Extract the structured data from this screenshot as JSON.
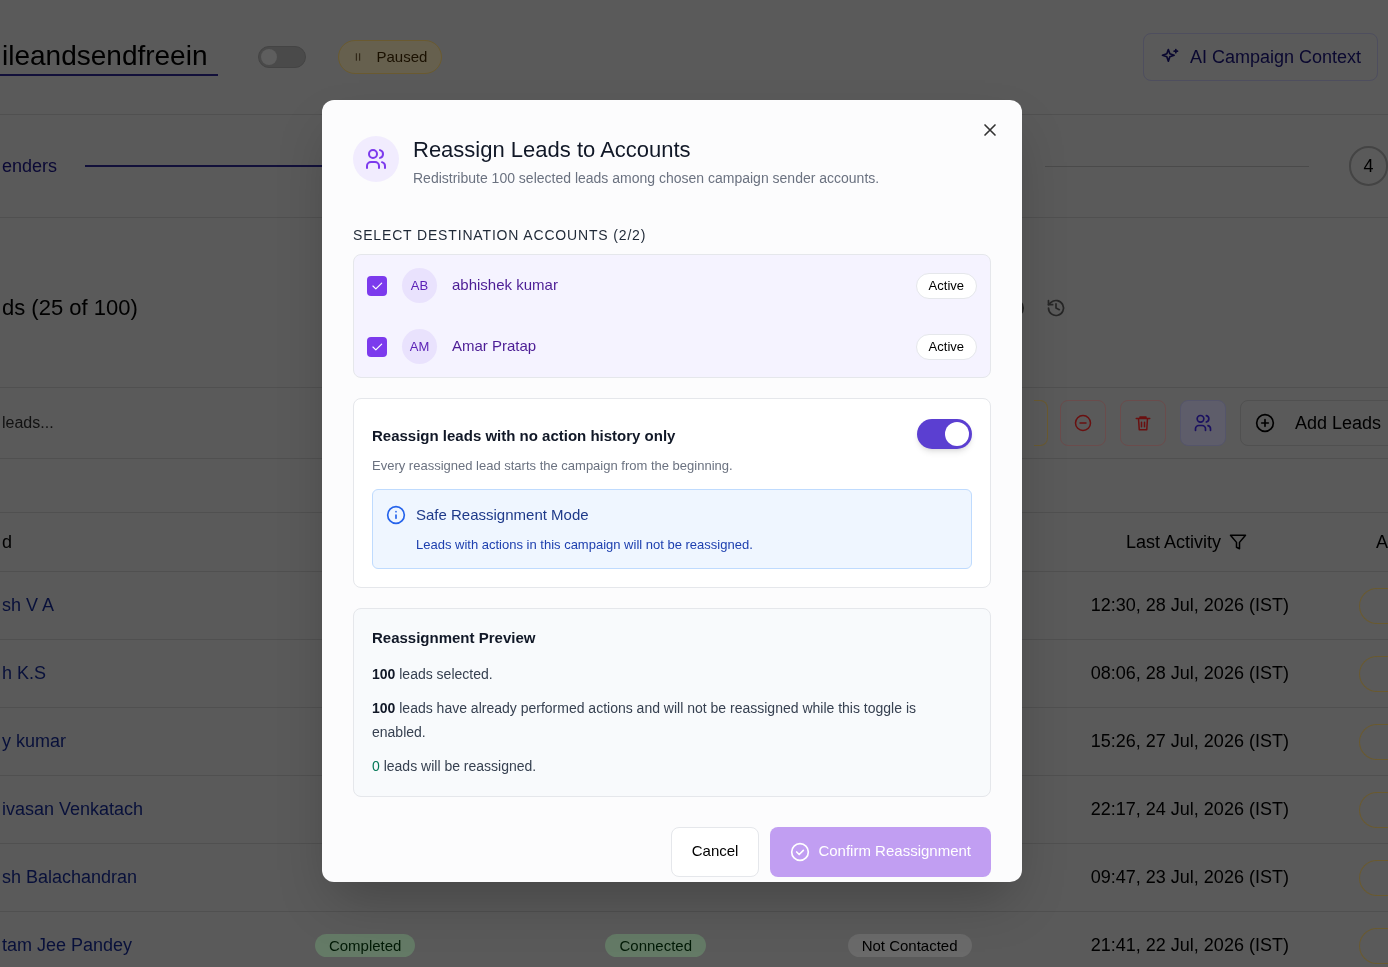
{
  "page": {
    "title": "ileandsendfreein",
    "campaign_toggle": {
      "on": false
    },
    "status": "Paused",
    "ai_button": "AI Campaign Context",
    "tab": "enders",
    "step": "4",
    "leads_heading": "ds (25 of 100)",
    "search": {
      "placeholder": "leads..."
    },
    "add_leads": "Add Leads",
    "table": {
      "columns": [
        "d",
        "Last Activity",
        "A"
      ],
      "rows": [
        {
          "name": "sh V A",
          "last_activity": "12:30, 28 Jul, 2026 (IST)"
        },
        {
          "name": "h K.S",
          "last_activity": "08:06, 28 Jul, 2026 (IST)"
        },
        {
          "name": "y kumar",
          "last_activity": "15:26, 27 Jul, 2026 (IST)"
        },
        {
          "name": "ivasan Venkatach",
          "last_activity": "22:17, 24 Jul, 2026 (IST)"
        },
        {
          "name": "sh Balachandran",
          "last_activity": "09:47, 23 Jul, 2026 (IST)"
        },
        {
          "name": "tam Jee Pandey",
          "status": "Completed",
          "connection": "Connected",
          "contact": "Not Contacted",
          "last_activity": "21:41, 22 Jul, 2026 (IST)"
        }
      ]
    }
  },
  "dialog": {
    "title": "Reassign Leads to Accounts",
    "subtitle": "Redistribute 100 selected leads among chosen campaign sender accounts.",
    "section_label": "SELECT DESTINATION ACCOUNTS (2/2)",
    "accounts": [
      {
        "initials": "AB",
        "name": "abhishek kumar",
        "status": "Active",
        "checked": true
      },
      {
        "initials": "AM",
        "name": "Amar Pratap",
        "status": "Active",
        "checked": true
      }
    ],
    "toggle": {
      "label": "Reassign leads with no action history only",
      "description": "Every reassigned lead starts the campaign from the beginning.",
      "on": true
    },
    "info": {
      "title": "Safe Reassignment Mode",
      "text": "Leads with actions in this campaign will not be reassigned."
    },
    "preview": {
      "title": "Reassignment Preview",
      "lines": [
        {
          "kind": "count",
          "count": "100",
          "text": "leads selected."
        },
        {
          "kind": "count",
          "count": "100",
          "text": "leads have already performed actions and will not be reassigned while this toggle is enabled."
        },
        {
          "kind": "result",
          "count": "0",
          "text": "leads will be reassigned."
        }
      ]
    },
    "cancel": "Cancel",
    "confirm": {
      "label": "Confirm Reassignment",
      "disabled": true
    }
  }
}
